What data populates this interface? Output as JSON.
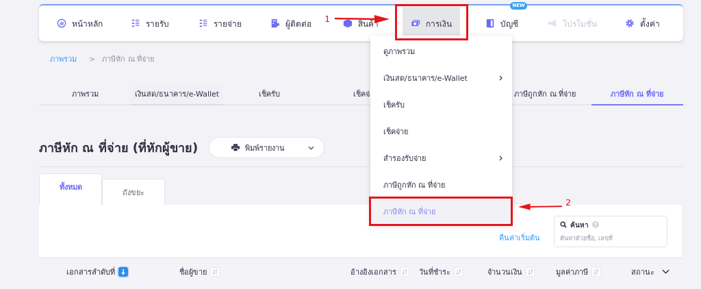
{
  "nav": [
    {
      "label": "หน้าหลัก",
      "selected": false,
      "disabled": false
    },
    {
      "label": "รายรับ",
      "selected": false,
      "disabled": false
    },
    {
      "label": "รายจ่าย",
      "selected": false,
      "disabled": false
    },
    {
      "label": "ผู้ติดต่อ",
      "selected": false,
      "disabled": false
    },
    {
      "label": "สินค้า",
      "selected": false,
      "disabled": false
    },
    {
      "label": "การเงิน",
      "selected": true,
      "disabled": false
    },
    {
      "label": "บัญชี",
      "selected": false,
      "disabled": false,
      "badge": "NEW"
    },
    {
      "label": "โปรโมชั่น",
      "selected": false,
      "disabled": true
    },
    {
      "label": "ตั้งค่า",
      "selected": false,
      "disabled": false
    }
  ],
  "breadcrumb": {
    "link": "ภาพรวม",
    "separator": ">",
    "current": "ภาษีหัก ณ ที่จ่าย"
  },
  "sub_tabs": [
    {
      "label": "ภาพรวม",
      "selected": false
    },
    {
      "label": "เงินสด/ธนาคาร/e-Wallet",
      "selected": false
    },
    {
      "label": "เช็ครับ",
      "selected": false
    },
    {
      "label": "เช็คจ่",
      "selected": false
    },
    {
      "label": "ภาษีถูกหัก ณ ที่จ่าย",
      "selected": false
    },
    {
      "label": "ภาษีหัก ณ ที่จ่าย",
      "selected": true
    }
  ],
  "heading": "ภาษีหัก ณ ที่จ่าย (ที่หักผู้ขาย)",
  "print_button": "พิมพ์รายงาน",
  "list_tabs": [
    {
      "label": "ทั้งหมด",
      "selected": true
    },
    {
      "label": "ถังขยะ",
      "selected": false
    }
  ],
  "reset_link": "คืนค่าเริ่มต้น",
  "search": {
    "label": "ค้นหา",
    "placeholder": "ค้นหาด้วยชื่อ, เลขที่"
  },
  "columns": [
    {
      "label": "เอกสารลำดับที่",
      "kind": "sort",
      "sorted": true
    },
    {
      "label": "ชื่อผู้ขาย",
      "kind": "sort",
      "sorted": false
    },
    {
      "label": "อ้างอิงเอกสาร",
      "kind": "sort",
      "sorted": false
    },
    {
      "label": "วันที่ชำระ",
      "kind": "sort",
      "sorted": false
    },
    {
      "label": "จำนวนเงิน",
      "kind": "sort",
      "sorted": false
    },
    {
      "label": "มูลค่าภาษี",
      "kind": "sort",
      "sorted": false
    },
    {
      "label": "สถานะ",
      "kind": "filter",
      "sorted": false
    }
  ],
  "menu": [
    {
      "label": "ดูภาพรวม",
      "submenu": false,
      "selected": false
    },
    {
      "label": "เงินสด/ธนาคาร/e-Wallet",
      "submenu": true,
      "selected": false
    },
    {
      "label": "เช็ครับ",
      "submenu": false,
      "selected": false
    },
    {
      "label": "เช็คจ่าย",
      "submenu": false,
      "selected": false
    },
    {
      "label": "สำรองรับจ่าย",
      "submenu": true,
      "selected": false
    },
    {
      "label": "ภาษีถูกหัก ณ ที่จ่าย",
      "submenu": false,
      "selected": false
    },
    {
      "label": "ภาษีหัก ณ ที่จ่าย",
      "submenu": false,
      "selected": true
    }
  ],
  "annotations": [
    {
      "kind": "step",
      "label": "1"
    },
    {
      "kind": "step",
      "label": "2"
    }
  ]
}
